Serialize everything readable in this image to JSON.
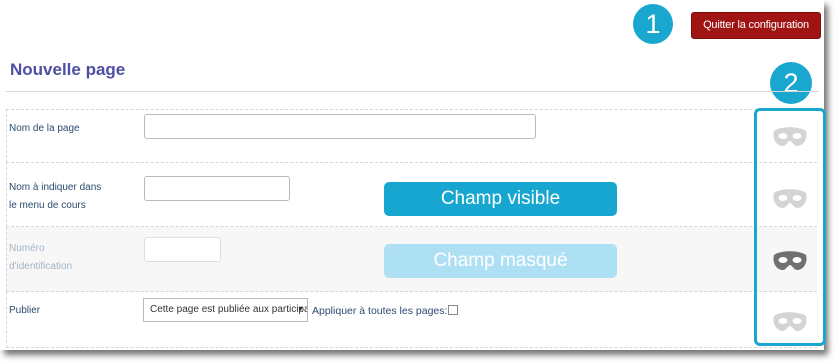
{
  "markers": {
    "one": "1",
    "two": "2"
  },
  "header": {
    "quit_label": "Quitter la configuration"
  },
  "title": "Nouvelle page",
  "fields": {
    "page_name": {
      "label": "Nom de la page",
      "value": ""
    },
    "menu_name": {
      "label_line1": "Nom à indiquer dans",
      "label_line2": "le menu de cours",
      "value": ""
    },
    "id_number": {
      "label_line1": "Numéro",
      "label_line2": "d'identification",
      "value": ""
    },
    "publish": {
      "label": "Publier",
      "selected": "Cette page est publiée aux participants",
      "apply_all_label": "Appliquer à toutes les pages:"
    }
  },
  "badges": {
    "visible": "Champ visible",
    "hidden": "Champ masqué"
  },
  "masks": [
    {
      "icon": "mask-icon",
      "state": "visible",
      "color": "#d4d4d4"
    },
    {
      "icon": "mask-icon",
      "state": "visible",
      "color": "#d4d4d4"
    },
    {
      "icon": "mask-icon",
      "state": "hidden",
      "color": "#707070"
    },
    {
      "icon": "mask-icon",
      "state": "visible",
      "color": "#d4d4d4"
    }
  ],
  "colors": {
    "accent": "#1aa7cf",
    "quit_button": "#a01414",
    "title": "#4e4fa0"
  }
}
